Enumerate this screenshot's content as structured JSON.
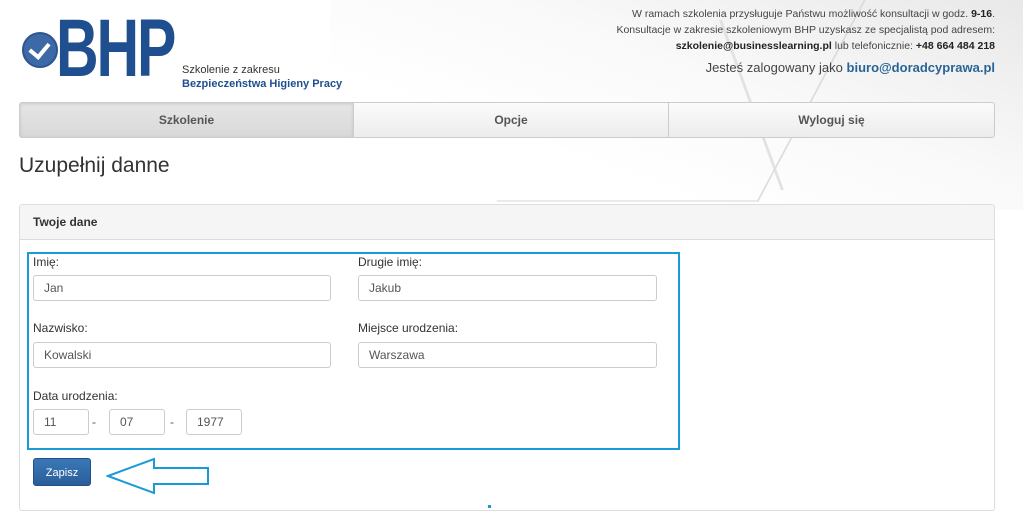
{
  "header": {
    "logo_text": "BHP",
    "logo_subtitle_1": "Szkolenie z zakresu",
    "logo_subtitle_2": "Bezpieczeństwa Higieny Pracy",
    "contact_line1_prefix": "W ramach szkolenia przysługuje Państwu możliwość konsultacji w godz.",
    "contact_line1_hours": "9-16",
    "contact_line2": "Konsultacje w zakresie szkoleniowym BHP uzyskasz ze specjalistą pod adresem:",
    "contact_email": "szkolenie@businesslearning.pl",
    "contact_phone_prefix": "lub telefonicznie:",
    "contact_phone": "+48 664 484 218",
    "logged_prefix": "Jesteś zalogowany jako",
    "logged_email": "biuro@doradcyprawa.pl"
  },
  "nav": {
    "items": [
      {
        "label": "Szkolenie",
        "active": true
      },
      {
        "label": "Opcje",
        "active": false
      },
      {
        "label": "Wyloguj się",
        "active": false
      }
    ]
  },
  "page": {
    "title": "Uzupełnij danne"
  },
  "panel": {
    "heading": "Twoje dane",
    "fields": {
      "first_name": {
        "label": "Imię:",
        "value": "Jan"
      },
      "second_name": {
        "label": "Drugie imię:",
        "value": "Jakub"
      },
      "last_name": {
        "label": "Nazwisko:",
        "value": "Kowalski"
      },
      "birth_place": {
        "label": "Miejsce urodzenia:",
        "value": "Warszawa"
      },
      "birth_date": {
        "label": "Data urodzenia:",
        "day": "11",
        "month": "07",
        "year": "1977",
        "separator": "-"
      }
    },
    "save_label": "Zapisz"
  },
  "colors": {
    "brand_blue": "#1f4f8f",
    "highlight": "#1a9ad6",
    "button": "#2a5e99"
  }
}
